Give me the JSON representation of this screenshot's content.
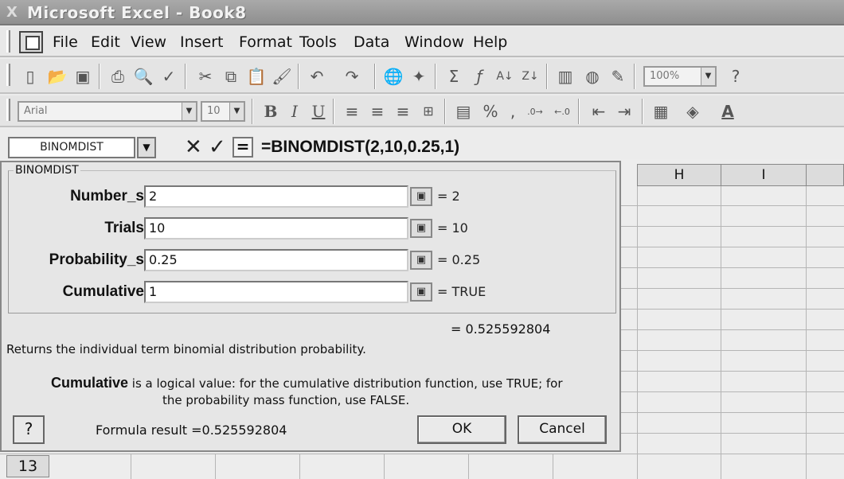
{
  "app": {
    "title": "Microsoft Excel - Book8"
  },
  "menu": {
    "items": [
      "File",
      "Edit",
      "View",
      "Insert",
      "Format",
      "Tools",
      "Data",
      "Window",
      "Help"
    ]
  },
  "toolbar": {
    "zoom": "100%",
    "font_name": "Arial",
    "font_size": "10",
    "percent_label": "%",
    "comma_label": ","
  },
  "formula_bar": {
    "name_box": "BINOMDIST",
    "cancel_symbol": "✕",
    "enter_symbol": "✓",
    "equals_symbol": "=",
    "formula": "=BINOMDIST(2,10,0.25,1)"
  },
  "sheet": {
    "column_headers": [
      "H",
      "I"
    ],
    "row_number": "13"
  },
  "dialog": {
    "title": "BINOMDIST",
    "arguments": [
      {
        "label": "Number_s",
        "value": "2",
        "result": "= 2"
      },
      {
        "label": "Trials",
        "value": "10",
        "result": "= 10"
      },
      {
        "label": "Probability_s",
        "value": "0.25",
        "result": "= 0.25"
      },
      {
        "label": "Cumulative",
        "value": "1",
        "result": "= TRUE"
      }
    ],
    "overall_result": "= 0.525592804",
    "description": "Returns the individual term binomial distribution probability.",
    "help_argument": "Cumulative",
    "help_text_1": " is a logical value: for the cumulative distribution function, use TRUE; for",
    "help_text_2": "the probability mass function, use FALSE.",
    "help_button": "?",
    "formula_result": "Formula result =0.525592804",
    "ok_label": "OK",
    "cancel_label": "Cancel"
  }
}
